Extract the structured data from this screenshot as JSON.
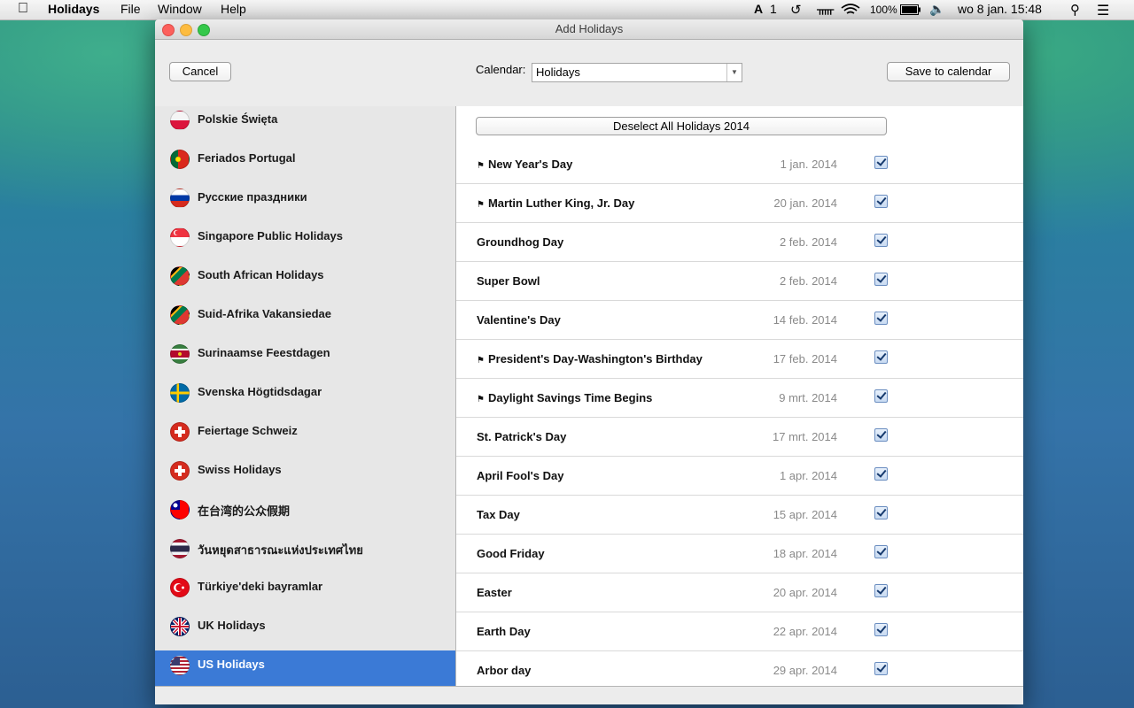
{
  "menubar": {
    "app": "Holidays",
    "items": [
      "File",
      "Window",
      "Help"
    ],
    "status": {
      "keyboard": "1",
      "battery": "100%",
      "clock": "wo 8 jan.  15:48"
    }
  },
  "window": {
    "title": "Add Holidays",
    "cancel": "Cancel",
    "calendar_label": "Calendar:",
    "calendar_value": "Holidays",
    "save": "Save to calendar",
    "deselect": "Deselect All Holidays 2014"
  },
  "sidebar": [
    {
      "label": "Polskie Święta",
      "flag": "pl"
    },
    {
      "label": "Feriados Portugal",
      "flag": "pt"
    },
    {
      "label": "Русские праздники",
      "flag": "ru"
    },
    {
      "label": "Singapore Public Holidays",
      "flag": "sg"
    },
    {
      "label": "South African Holidays",
      "flag": "za"
    },
    {
      "label": "Suid-Afrika Vakansiedae",
      "flag": "za"
    },
    {
      "label": "Surinaamse Feestdagen",
      "flag": "sr"
    },
    {
      "label": "Svenska Högtidsdagar",
      "flag": "se"
    },
    {
      "label": "Feiertage Schweiz",
      "flag": "ch"
    },
    {
      "label": "Swiss Holidays",
      "flag": "ch"
    },
    {
      "label": "在台湾的公众假期",
      "flag": "tw"
    },
    {
      "label": "วันหยุดสาธารณะแห่งประเทศไทย",
      "flag": "th"
    },
    {
      "label": "Türkiye'deki bayramlar",
      "flag": "tr"
    },
    {
      "label": "UK Holidays",
      "flag": "gb"
    },
    {
      "label": "US Holidays",
      "flag": "us",
      "selected": true
    }
  ],
  "holidays": [
    {
      "name": "New Year's Day",
      "date": "1 jan. 2014",
      "flag": true
    },
    {
      "name": "Martin Luther King, Jr. Day",
      "date": "20 jan. 2014",
      "flag": true
    },
    {
      "name": "Groundhog Day",
      "date": "2 feb. 2014",
      "flag": false
    },
    {
      "name": "Super Bowl",
      "date": "2 feb. 2014",
      "flag": false
    },
    {
      "name": "Valentine's Day",
      "date": "14 feb. 2014",
      "flag": false
    },
    {
      "name": "President's Day-Washington's Birthday",
      "date": "17 feb. 2014",
      "flag": true
    },
    {
      "name": "Daylight Savings Time Begins",
      "date": "9 mrt. 2014",
      "flag": true
    },
    {
      "name": "St. Patrick's Day",
      "date": "17 mrt. 2014",
      "flag": false
    },
    {
      "name": "April Fool's Day",
      "date": "1 apr. 2014",
      "flag": false
    },
    {
      "name": "Tax Day",
      "date": "15 apr. 2014",
      "flag": false
    },
    {
      "name": "Good Friday",
      "date": "18 apr. 2014",
      "flag": false
    },
    {
      "name": "Easter",
      "date": "20 apr. 2014",
      "flag": false
    },
    {
      "name": "Earth Day",
      "date": "22 apr. 2014",
      "flag": false
    },
    {
      "name": "Arbor day",
      "date": "29 apr. 2014",
      "flag": false
    }
  ]
}
